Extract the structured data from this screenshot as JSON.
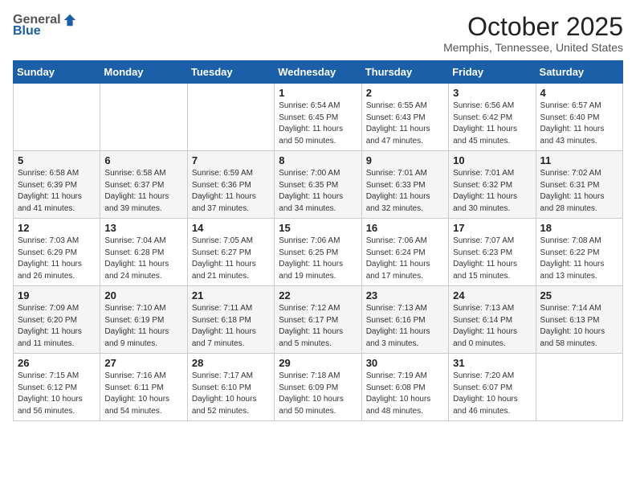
{
  "header": {
    "logo_general": "General",
    "logo_blue": "Blue",
    "month_title": "October 2025",
    "location": "Memphis, Tennessee, United States"
  },
  "weekdays": [
    "Sunday",
    "Monday",
    "Tuesday",
    "Wednesday",
    "Thursday",
    "Friday",
    "Saturday"
  ],
  "weeks": [
    [
      {
        "day": "",
        "info": ""
      },
      {
        "day": "",
        "info": ""
      },
      {
        "day": "",
        "info": ""
      },
      {
        "day": "1",
        "info": "Sunrise: 6:54 AM\nSunset: 6:45 PM\nDaylight: 11 hours\nand 50 minutes."
      },
      {
        "day": "2",
        "info": "Sunrise: 6:55 AM\nSunset: 6:43 PM\nDaylight: 11 hours\nand 47 minutes."
      },
      {
        "day": "3",
        "info": "Sunrise: 6:56 AM\nSunset: 6:42 PM\nDaylight: 11 hours\nand 45 minutes."
      },
      {
        "day": "4",
        "info": "Sunrise: 6:57 AM\nSunset: 6:40 PM\nDaylight: 11 hours\nand 43 minutes."
      }
    ],
    [
      {
        "day": "5",
        "info": "Sunrise: 6:58 AM\nSunset: 6:39 PM\nDaylight: 11 hours\nand 41 minutes."
      },
      {
        "day": "6",
        "info": "Sunrise: 6:58 AM\nSunset: 6:37 PM\nDaylight: 11 hours\nand 39 minutes."
      },
      {
        "day": "7",
        "info": "Sunrise: 6:59 AM\nSunset: 6:36 PM\nDaylight: 11 hours\nand 37 minutes."
      },
      {
        "day": "8",
        "info": "Sunrise: 7:00 AM\nSunset: 6:35 PM\nDaylight: 11 hours\nand 34 minutes."
      },
      {
        "day": "9",
        "info": "Sunrise: 7:01 AM\nSunset: 6:33 PM\nDaylight: 11 hours\nand 32 minutes."
      },
      {
        "day": "10",
        "info": "Sunrise: 7:01 AM\nSunset: 6:32 PM\nDaylight: 11 hours\nand 30 minutes."
      },
      {
        "day": "11",
        "info": "Sunrise: 7:02 AM\nSunset: 6:31 PM\nDaylight: 11 hours\nand 28 minutes."
      }
    ],
    [
      {
        "day": "12",
        "info": "Sunrise: 7:03 AM\nSunset: 6:29 PM\nDaylight: 11 hours\nand 26 minutes."
      },
      {
        "day": "13",
        "info": "Sunrise: 7:04 AM\nSunset: 6:28 PM\nDaylight: 11 hours\nand 24 minutes."
      },
      {
        "day": "14",
        "info": "Sunrise: 7:05 AM\nSunset: 6:27 PM\nDaylight: 11 hours\nand 21 minutes."
      },
      {
        "day": "15",
        "info": "Sunrise: 7:06 AM\nSunset: 6:25 PM\nDaylight: 11 hours\nand 19 minutes."
      },
      {
        "day": "16",
        "info": "Sunrise: 7:06 AM\nSunset: 6:24 PM\nDaylight: 11 hours\nand 17 minutes."
      },
      {
        "day": "17",
        "info": "Sunrise: 7:07 AM\nSunset: 6:23 PM\nDaylight: 11 hours\nand 15 minutes."
      },
      {
        "day": "18",
        "info": "Sunrise: 7:08 AM\nSunset: 6:22 PM\nDaylight: 11 hours\nand 13 minutes."
      }
    ],
    [
      {
        "day": "19",
        "info": "Sunrise: 7:09 AM\nSunset: 6:20 PM\nDaylight: 11 hours\nand 11 minutes."
      },
      {
        "day": "20",
        "info": "Sunrise: 7:10 AM\nSunset: 6:19 PM\nDaylight: 11 hours\nand 9 minutes."
      },
      {
        "day": "21",
        "info": "Sunrise: 7:11 AM\nSunset: 6:18 PM\nDaylight: 11 hours\nand 7 minutes."
      },
      {
        "day": "22",
        "info": "Sunrise: 7:12 AM\nSunset: 6:17 PM\nDaylight: 11 hours\nand 5 minutes."
      },
      {
        "day": "23",
        "info": "Sunrise: 7:13 AM\nSunset: 6:16 PM\nDaylight: 11 hours\nand 3 minutes."
      },
      {
        "day": "24",
        "info": "Sunrise: 7:13 AM\nSunset: 6:14 PM\nDaylight: 11 hours\nand 0 minutes."
      },
      {
        "day": "25",
        "info": "Sunrise: 7:14 AM\nSunset: 6:13 PM\nDaylight: 10 hours\nand 58 minutes."
      }
    ],
    [
      {
        "day": "26",
        "info": "Sunrise: 7:15 AM\nSunset: 6:12 PM\nDaylight: 10 hours\nand 56 minutes."
      },
      {
        "day": "27",
        "info": "Sunrise: 7:16 AM\nSunset: 6:11 PM\nDaylight: 10 hours\nand 54 minutes."
      },
      {
        "day": "28",
        "info": "Sunrise: 7:17 AM\nSunset: 6:10 PM\nDaylight: 10 hours\nand 52 minutes."
      },
      {
        "day": "29",
        "info": "Sunrise: 7:18 AM\nSunset: 6:09 PM\nDaylight: 10 hours\nand 50 minutes."
      },
      {
        "day": "30",
        "info": "Sunrise: 7:19 AM\nSunset: 6:08 PM\nDaylight: 10 hours\nand 48 minutes."
      },
      {
        "day": "31",
        "info": "Sunrise: 7:20 AM\nSunset: 6:07 PM\nDaylight: 10 hours\nand 46 minutes."
      },
      {
        "day": "",
        "info": ""
      }
    ]
  ]
}
